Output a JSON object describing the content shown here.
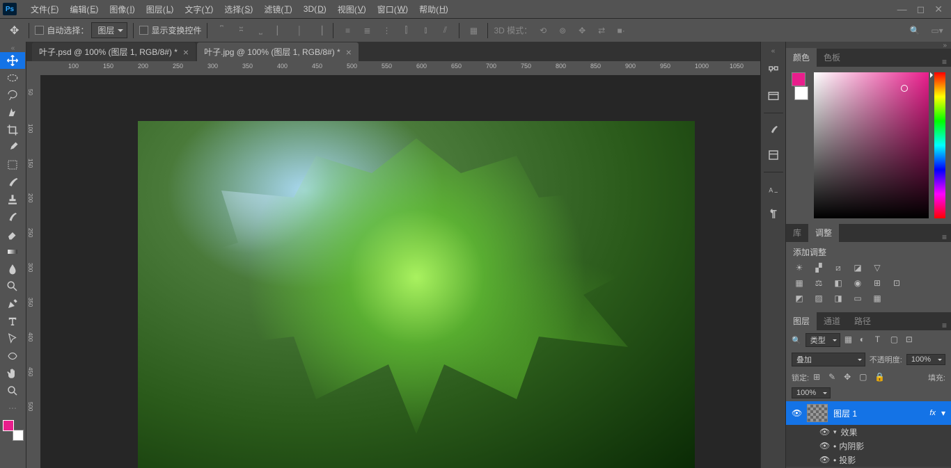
{
  "menubar": {
    "items": [
      {
        "label": "文件",
        "key": "F"
      },
      {
        "label": "编辑",
        "key": "E"
      },
      {
        "label": "图像",
        "key": "I"
      },
      {
        "label": "图层",
        "key": "L"
      },
      {
        "label": "文字",
        "key": "Y"
      },
      {
        "label": "选择",
        "key": "S"
      },
      {
        "label": "滤镜",
        "key": "T"
      },
      {
        "label": "3D",
        "key": "D"
      },
      {
        "label": "视图",
        "key": "V"
      },
      {
        "label": "窗口",
        "key": "W"
      },
      {
        "label": "帮助",
        "key": "H"
      }
    ]
  },
  "optbar": {
    "auto_select": "自动选择：",
    "target_drop": "图层",
    "show_transform": "显示变换控件",
    "mode3d_label": "3D 模式："
  },
  "tabs": [
    {
      "title": "叶子.psd @ 100% (图层 1, RGB/8#) *",
      "active": false
    },
    {
      "title": "叶子.jpg @ 100% (图层 1, RGB/8#) *",
      "active": true
    }
  ],
  "ruler": {
    "h": [
      "100",
      "150",
      "200",
      "250",
      "300",
      "350",
      "400",
      "450",
      "500",
      "550",
      "600",
      "650",
      "700",
      "750",
      "800",
      "850",
      "900",
      "950",
      "1000",
      "1050"
    ],
    "v": [
      "50",
      "100",
      "150",
      "200",
      "250",
      "300",
      "350",
      "400",
      "450",
      "500"
    ]
  },
  "colorPanel": {
    "tabs": [
      "颜色",
      "色板"
    ],
    "fg_color": "#e91e8c"
  },
  "adjustPanel": {
    "tabs": [
      "库",
      "调整"
    ],
    "title": "添加调整"
  },
  "layersPanel": {
    "tabs": [
      "图层",
      "通道",
      "路径"
    ],
    "filter_label": "类型",
    "blend_mode": "叠加",
    "opacity_label": "不透明度:",
    "opacity_value": "100%",
    "lock_label": "锁定:",
    "fill_label": "填充:",
    "fill_value": "100%",
    "layers": [
      {
        "name": "图层 1",
        "active": true,
        "fx": "fx"
      }
    ],
    "effects": {
      "label": "效果",
      "items": [
        "内阴影",
        "投影"
      ]
    }
  },
  "fg_color": "#e91e8c"
}
